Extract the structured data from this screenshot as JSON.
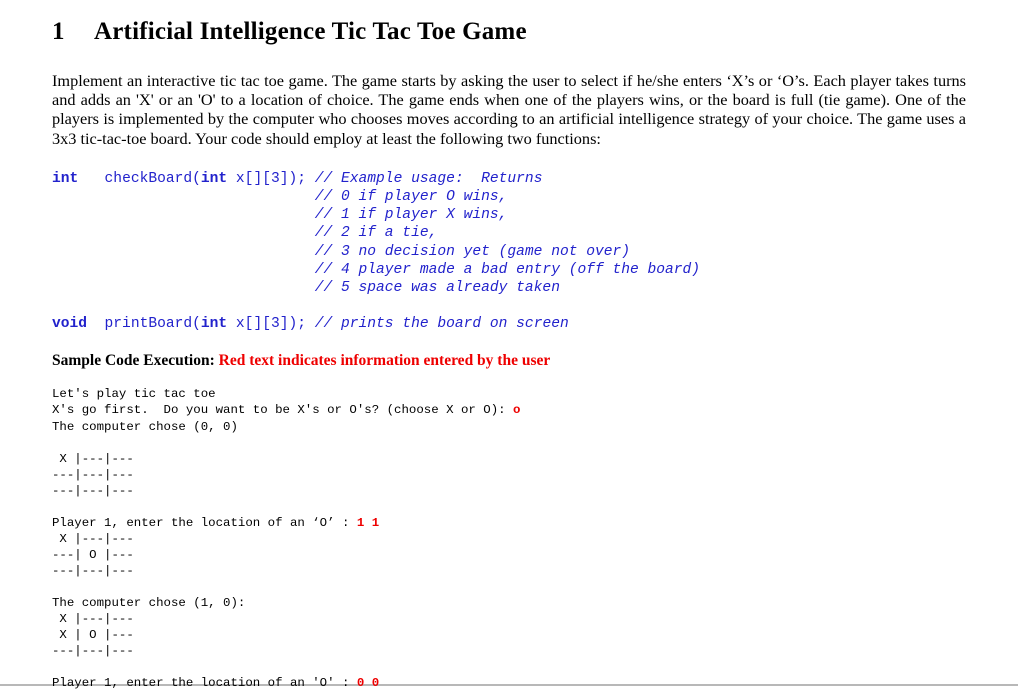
{
  "document": {
    "section_number": "1",
    "title": "Artificial Intelligence Tic Tac Toe Game",
    "paragraph": "Implement an interactive tic tac toe game. The game starts by asking the user to select if he/she enters ‘X’s or ‘O’s. Each player takes turns and adds an 'X' or an 'O' to a location of choice. The game ends when one of the players wins, or the board is full (tie game). One of the players is implemented by the computer who chooses moves according to an artificial intelligence strategy of your choice. The game uses a 3x3 tic-tac-toe board. Your code should employ at least the following two functions:"
  },
  "code": {
    "color": "#2222CC",
    "check_board": {
      "keyword": "int",
      "signature": "   checkBoard(",
      "param_keyword": "int",
      "param_rest": " x[][3]); ",
      "comment_head": "// Example usage:  Returns",
      "comment_lines": [
        "// 0 if player O wins,",
        "// 1 if player X wins,",
        "// 2 if a tie,",
        "// 3 no decision yet (game not over)",
        "// 4 player made a bad entry (off the board)",
        "// 5 space was already taken"
      ]
    },
    "print_board": {
      "keyword": "void",
      "signature": "  printBoard(",
      "param_keyword": "int",
      "param_rest": " x[][3]); ",
      "comment": "// prints the board on screen"
    }
  },
  "sample": {
    "label": "Sample Code Execution: ",
    "note": "Red text indicates information entered by the user",
    "note_color": "#EE0000"
  },
  "terminal": {
    "user_input_color": "#EE0000",
    "lines": [
      {
        "type": "text",
        "text": "Let's play tic tac toe"
      },
      {
        "type": "prompt",
        "text": "X's go first.  Do you want to be X's or O's? (choose X or O): ",
        "input": "o"
      },
      {
        "type": "text",
        "text": "The computer chose (0, 0)"
      },
      {
        "type": "blank",
        "text": ""
      },
      {
        "type": "text",
        "text": " X |---|---"
      },
      {
        "type": "text",
        "text": "---|---|---"
      },
      {
        "type": "text",
        "text": "---|---|---"
      },
      {
        "type": "blank",
        "text": ""
      },
      {
        "type": "prompt",
        "text": "Player 1, enter the location of an ‘O’ : ",
        "input": "1 1"
      },
      {
        "type": "text",
        "text": " X |---|---"
      },
      {
        "type": "text",
        "text": "---| O |---"
      },
      {
        "type": "text",
        "text": "---|---|---"
      },
      {
        "type": "blank",
        "text": ""
      },
      {
        "type": "text",
        "text": "The computer chose (1, 0):"
      },
      {
        "type": "text",
        "text": " X |---|---"
      },
      {
        "type": "text",
        "text": " X | O |---"
      },
      {
        "type": "text",
        "text": "---|---|---"
      },
      {
        "type": "blank",
        "text": ""
      },
      {
        "type": "prompt",
        "text": "Player 1, enter the location of an 'O' : ",
        "input": "0 0"
      }
    ]
  }
}
